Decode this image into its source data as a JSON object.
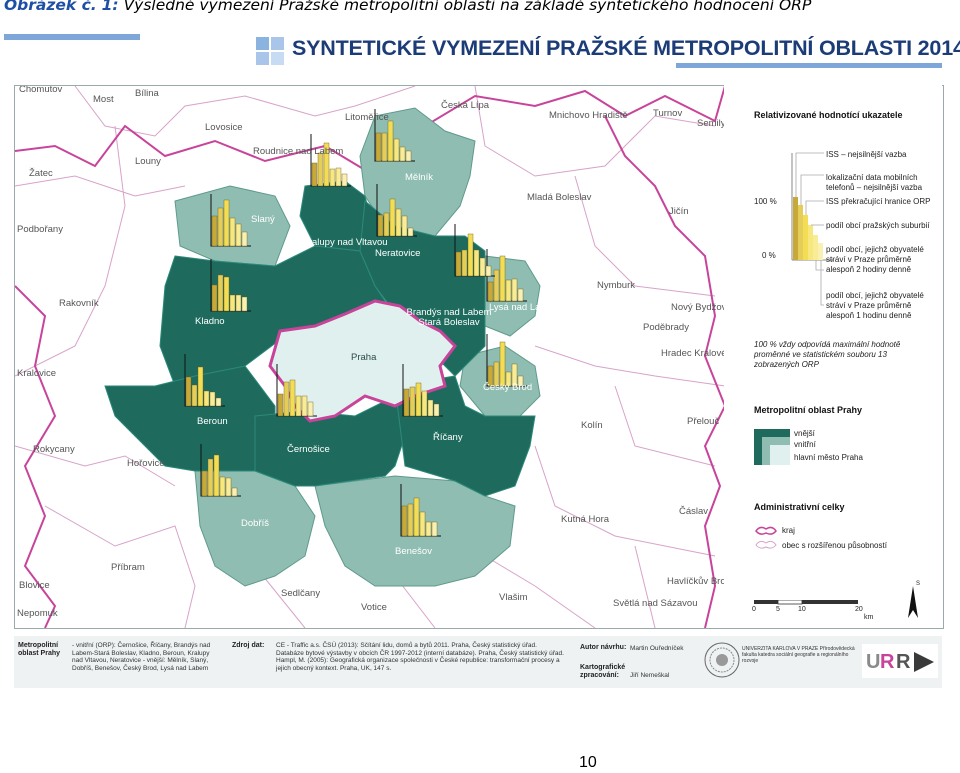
{
  "caption": {
    "prefix": "Obrázek č.",
    "number": "1:",
    "text": "Výsledné vymezení Pražské metropolitní oblasti na základě syntetického hodnocení ORP"
  },
  "banner_title": "SYNTETICKÉ VYMEZENÍ PRAŽSKÉ METROPOLITNÍ OBLASTI 2014",
  "colors": {
    "outer": "#1e6b5e",
    "inner": "#8fbdb1",
    "praha": "#dff0ee",
    "border": "#c8449a",
    "bar_dark": "#d4b84a",
    "bar_light": "#f4e36a"
  },
  "places": {
    "outside": [
      "Chomutov",
      "Most",
      "Bílina",
      "Lovosice",
      "Litoměřice",
      "Česká Lípa",
      "Mnichovo Hradiště",
      "Turnov",
      "Semily",
      "Louny",
      "Žatec",
      "Roudnice nad Labem",
      "Mladá Boleslav",
      "Jičín",
      "Podbořany",
      "Rakovník",
      "Nymburk",
      "Nový Bydžov",
      "Poděbrady",
      "Hradec Králové",
      "Kralovice",
      "Rokycany",
      "Hořovice",
      "Kolín",
      "Přelouč",
      "Kutná Hora",
      "Čáslav",
      "Příbram",
      "Blovice",
      "Nepomuk",
      "Sedlčany",
      "Votice",
      "Vlašim",
      "Havlíčkův Brod",
      "Světlá nad Sázavou"
    ],
    "inner": [
      "Mělník",
      "Slaný",
      "Lysá nad Labem",
      "Český Brod",
      "Dobříš",
      "Benešov"
    ],
    "outer": [
      "Kralupy nad Vltavou",
      "Neratovice",
      "Brandýs nad Labem Stará Boleslav",
      "Kladno",
      "Beroun",
      "Černošice",
      "Říčany"
    ],
    "center": "Praha"
  },
  "legend": {
    "title1": "Relativizované hodnotící ukazatele",
    "items": [
      "ISS – nejsilnější vazba",
      "lokalizační data mobilních telefonů – nejsilnější vazba",
      "ISS překračující hranice ORP",
      "podíl obcí pražských suburbií",
      "podíl obcí, jejichž obyvatelé stráví v Praze průměrně alespoň 2 hodiny denně",
      "podíl obcí, jejichž obyvatelé stráví v Praze průměrně alespoň 1 hodinu denně"
    ],
    "pct100": "100 %",
    "pct0": "0 %",
    "note": "100 % vždy odpovídá maximální hodnotě proměnné ve statistickém souboru 13 zobrazených ORP",
    "title2": "Metropolitní oblast Prahy",
    "zones": [
      "vnější",
      "vnitřní",
      "hlavní město Praha"
    ],
    "title3": "Administrativní celky",
    "admin": [
      "kraj",
      "obec s rozšířenou působností"
    ],
    "scale": [
      "0",
      "5",
      "10",
      "20"
    ],
    "scale_unit": "km",
    "north": "S"
  },
  "footer": {
    "h1": "Metropolitní oblast Prahy",
    "t1": "- vnitřní (ORP): Černošice, Říčany, Brandýs nad Labem-Stará Boleslav, Kladno, Beroun, Kralupy nad Vltavou, Neratovice - vnější: Mělník, Slaný, Dobříš, Benešov, Český Brod, Lysá nad Labem",
    "h2": "Zdroj dat:",
    "t2": "CE - Traffic a.s. ČSÚ (2013): Sčítání lidu, domů a bytů 2011. Praha, Český statistický úřad. Databáze bytové výstavby v obcích ČR 1997-2012 (interní databáze). Praha, Český statistický úřad. Hampl, M. (2005): Geografická organizace společnosti v České republice: transformační procesy a jejich obecný kontext. Praha, UK, 147 s.",
    "h3": "Autor návrhu:",
    "t3": "Martin Ouředníček",
    "h4": "Kartografické zpracování:",
    "t4": "Jiří Nemeškal",
    "inst": "UNIVERZITA KARLOVA V PRAZE Přírodovědecká fakulta katedra sociální geografie a regionálního rozvoje",
    "logo2": "URRlab"
  },
  "page_number": "10"
}
